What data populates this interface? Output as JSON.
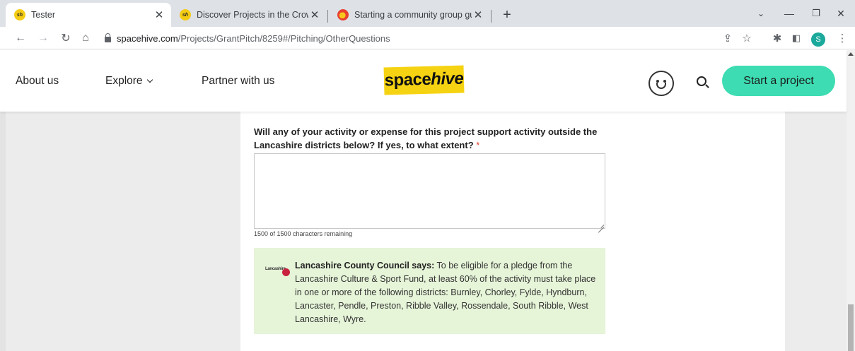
{
  "browser": {
    "tabs": [
      {
        "title": "Tester",
        "favicon": "sh-favicon"
      },
      {
        "title": "Discover Projects in the Crowdfu",
        "favicon": "sh-favicon"
      },
      {
        "title": "Starting a community group guid",
        "favicon": "community-guide-favicon"
      }
    ],
    "new_tab": "+",
    "url_host": "spacehive.com",
    "url_path": "/Projects/GrantPitch/8259#/Pitching/OtherQuestions",
    "profile_initial": "S"
  },
  "site": {
    "nav": {
      "about": "About us",
      "explore": "Explore",
      "partner": "Partner with us"
    },
    "logo": {
      "plain": "space",
      "italic": "hive",
      "color": "#f5d312"
    },
    "start_project": "Start a project",
    "accent_color": "#3ddcb2"
  },
  "form": {
    "question": "Will any of your activity or expense for this project support activity outside the Lancashire districts below? If yes, to what extent?",
    "required_mark": "*",
    "answer_value": "",
    "char_count": "1500 of 1500 characters remaining",
    "notice": {
      "logo_text": "Lancashire",
      "speaker": "Lancashire County Council says:",
      "message": "To be eligible for a pledge from the Lancashire Culture & Sport Fund, at least 60% of the activity must take place in one or more of the following districts: Burnley, Chorley, Fylde, Hyndburn, Lancaster, Pendle, Preston, Ribble Valley, Rossendale, South Ribble, West Lancashire, Wyre.",
      "background": "#e6f4d8"
    }
  }
}
